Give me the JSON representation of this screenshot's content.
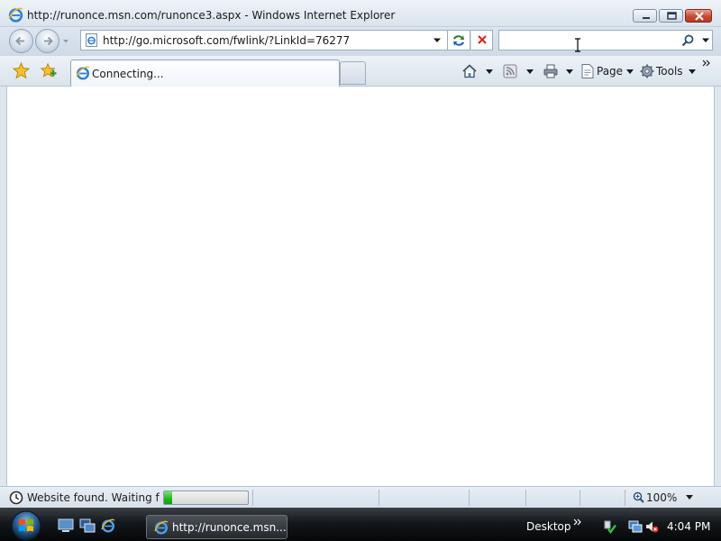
{
  "window": {
    "title": "http://runonce.msn.com/runonce3.aspx - Windows Internet Explorer"
  },
  "address_bar": {
    "url": "http://go.microsoft.com/fwlink/?LinkId=76277"
  },
  "search_box": {
    "value": "",
    "placeholder": ""
  },
  "tab": {
    "label": "Connecting..."
  },
  "command_bar": {
    "page_label": "Page",
    "tools_label": "Tools"
  },
  "status_bar": {
    "text": "Website found. Waiting for reply...",
    "progress": 0.1,
    "zoom": "100%"
  },
  "taskbar": {
    "task_label": "http://runonce.msn...",
    "desktop_toolbar": "Desktop",
    "clock": "4:04 PM"
  },
  "icons": {
    "title": "ie-logo-icon",
    "back": "back-arrow-icon",
    "forward": "forward-arrow-icon",
    "refresh": "refresh-icon",
    "stop": "stop-icon",
    "search": "search-icon",
    "favorites": "favorites-star-icon",
    "add_favorites": "add-favorites-icon",
    "home": "home-icon",
    "feeds": "feeds-icon",
    "print": "print-icon",
    "page": "page-icon",
    "tools": "gear-icon",
    "status": "clock-icon",
    "zoom": "zoom-icon",
    "start": "windows-orb-icon"
  },
  "colors": {
    "progress_green": "#1fb51c",
    "close_button": "#c74a34",
    "taskbar": "#14181c"
  }
}
